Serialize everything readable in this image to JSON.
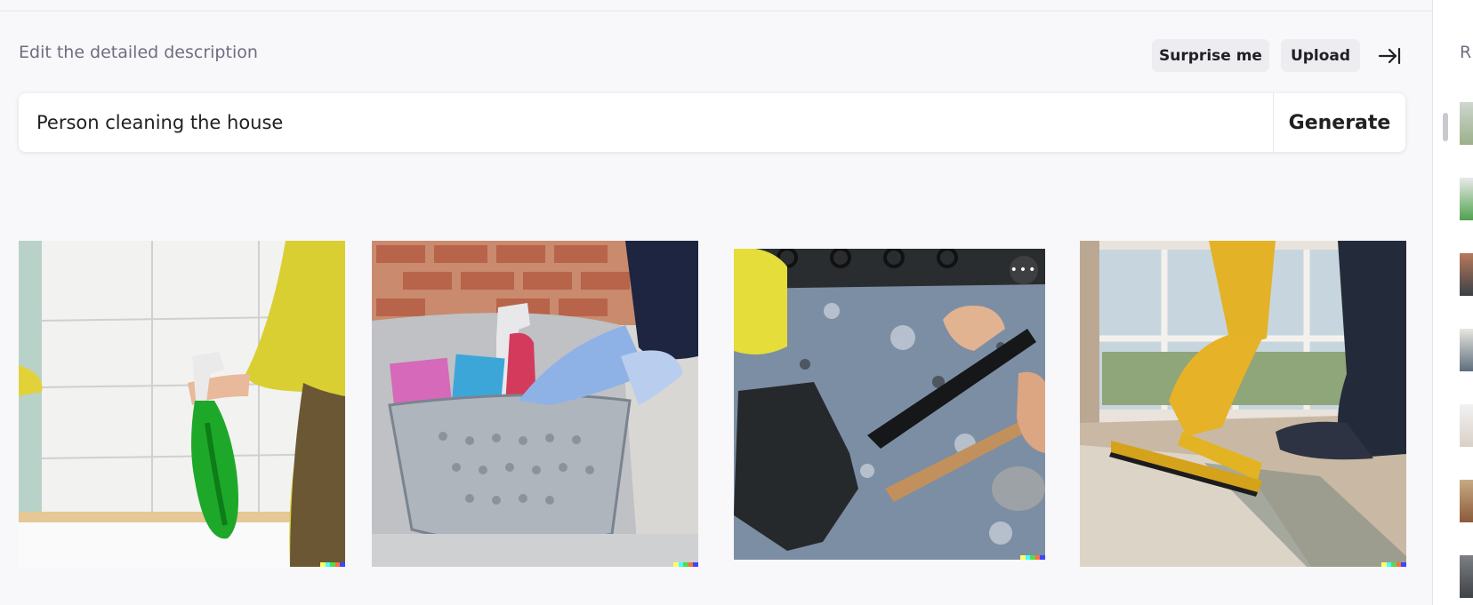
{
  "editor": {
    "label": "Edit the detailed description",
    "surprise_label": "Surprise me",
    "upload_label": "Upload",
    "prompt_value": "Person cleaning the house",
    "generate_label": "Generate"
  },
  "results": [
    {
      "description": "spray bottle cleaning"
    },
    {
      "description": "cleaning supplies basket"
    },
    {
      "description": "mopping stone floor"
    },
    {
      "description": "scrubbing floor with squeegee"
    }
  ],
  "colors": {
    "accent": "#202123",
    "chip_bg": "#ececf1",
    "muted_text": "#6e6e80",
    "stamp": [
      "#ffff66",
      "#42ffff",
      "#51da4c",
      "#ff6e3c",
      "#3c46ff"
    ]
  },
  "history_panel": {
    "label_char": "R",
    "thumbnail_count": 8
  }
}
